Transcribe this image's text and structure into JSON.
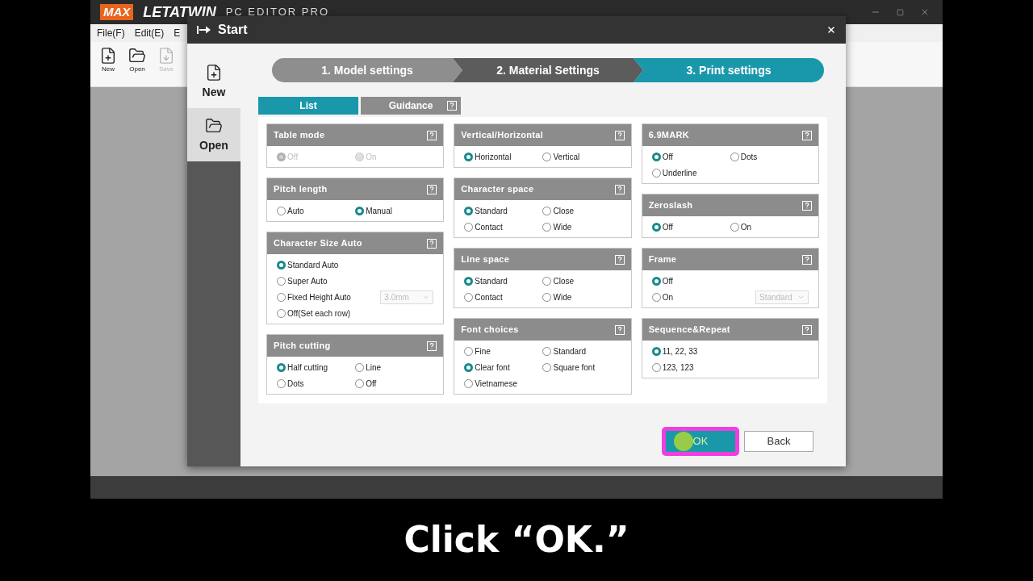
{
  "app": {
    "logo_badge": "MAX",
    "logo_name": "LETATWIN",
    "logo_product": "PC EDITOR PRO"
  },
  "menu": [
    "File(F)",
    "Edit(E)",
    "E"
  ],
  "toolbar": [
    {
      "label": "New",
      "kind": "new",
      "disabled": false
    },
    {
      "label": "Open",
      "kind": "open",
      "disabled": false
    },
    {
      "label": "Save",
      "kind": "save",
      "disabled": true
    }
  ],
  "dialog": {
    "title": "Start",
    "sidebar": [
      {
        "label": "New",
        "kind": "new",
        "selected": false
      },
      {
        "label": "Open",
        "kind": "open",
        "selected": true
      }
    ],
    "steps": [
      {
        "label": "1. Model settings",
        "kind": "pending"
      },
      {
        "label": "2. Material Settings",
        "kind": "done"
      },
      {
        "label": "3. Print settings",
        "kind": "current"
      }
    ],
    "tabs": [
      {
        "label": "List",
        "selected": true,
        "help": false
      },
      {
        "label": "Guidance",
        "selected": false,
        "help": true
      }
    ],
    "columns": [
      [
        {
          "title": "Table mode",
          "kind": "grid",
          "options": [
            {
              "label": "Off",
              "selected": true,
              "disabled": true
            },
            {
              "label": "On",
              "selected": false,
              "disabled": true
            }
          ]
        },
        {
          "title": "Pitch length",
          "kind": "grid",
          "options": [
            {
              "label": "Auto",
              "selected": false,
              "disabled": false
            },
            {
              "label": "Manual",
              "selected": true,
              "disabled": false
            }
          ]
        },
        {
          "title": "Character Size Auto",
          "kind": "list",
          "options": [
            {
              "label": "Standard Auto",
              "selected": true,
              "disabled": false
            },
            {
              "label": "Super Auto",
              "selected": false,
              "disabled": false
            },
            {
              "label": "Fixed Height Auto",
              "selected": false,
              "disabled": false,
              "dropdown": {
                "value": "3.0mm",
                "disabled": true
              }
            },
            {
              "label": "Off(Set each row)",
              "selected": false,
              "disabled": false
            }
          ]
        },
        {
          "title": "Pitch cutting",
          "kind": "grid",
          "options": [
            {
              "label": "Half cutting",
              "selected": true,
              "disabled": false
            },
            {
              "label": "Line",
              "selected": false,
              "disabled": false
            },
            {
              "label": "Dots",
              "selected": false,
              "disabled": false
            },
            {
              "label": "Off",
              "selected": false,
              "disabled": false
            }
          ]
        }
      ],
      [
        {
          "title": "Vertical/Horizontal",
          "kind": "grid",
          "options": [
            {
              "label": "Horizontal",
              "selected": true,
              "disabled": false
            },
            {
              "label": "Vertical",
              "selected": false,
              "disabled": false
            }
          ]
        },
        {
          "title": "Character space",
          "kind": "grid",
          "options": [
            {
              "label": "Standard",
              "selected": true,
              "disabled": false
            },
            {
              "label": "Close",
              "selected": false,
              "disabled": false
            },
            {
              "label": "Contact",
              "selected": false,
              "disabled": false
            },
            {
              "label": "Wide",
              "selected": false,
              "disabled": false
            }
          ]
        },
        {
          "title": "Line space",
          "kind": "grid",
          "options": [
            {
              "label": "Standard",
              "selected": true,
              "disabled": false
            },
            {
              "label": "Close",
              "selected": false,
              "disabled": false
            },
            {
              "label": "Contact",
              "selected": false,
              "disabled": false
            },
            {
              "label": "Wide",
              "selected": false,
              "disabled": false
            }
          ]
        },
        {
          "title": "Font choices",
          "kind": "grid",
          "options": [
            {
              "label": "Fine",
              "selected": false,
              "disabled": false
            },
            {
              "label": "Standard",
              "selected": false,
              "disabled": false
            },
            {
              "label": "Clear font",
              "selected": true,
              "disabled": false
            },
            {
              "label": "Square font",
              "selected": false,
              "disabled": false
            },
            {
              "label": "Vietnamese",
              "selected": false,
              "disabled": false
            }
          ]
        }
      ],
      [
        {
          "title": "6.9MARK",
          "kind": "grid",
          "options": [
            {
              "label": "Off",
              "selected": true,
              "disabled": false
            },
            {
              "label": "Dots",
              "selected": false,
              "disabled": false
            },
            {
              "label": "Underline",
              "selected": false,
              "disabled": false
            }
          ]
        },
        {
          "title": "Zeroslash",
          "kind": "grid",
          "options": [
            {
              "label": "Off",
              "selected": true,
              "disabled": false
            },
            {
              "label": "On",
              "selected": false,
              "disabled": false
            }
          ]
        },
        {
          "title": "Frame",
          "kind": "list",
          "options": [
            {
              "label": "Off",
              "selected": true,
              "disabled": false
            },
            {
              "label": "On",
              "selected": false,
              "disabled": false,
              "dropdown": {
                "value": "Standard",
                "disabled": true
              }
            }
          ]
        },
        {
          "title": "Sequence&Repeat",
          "kind": "list",
          "options": [
            {
              "label": "11, 22, 33",
              "selected": true,
              "disabled": false
            },
            {
              "label": "123, 123",
              "selected": false,
              "disabled": false
            }
          ]
        }
      ]
    ],
    "buttons": [
      {
        "label": "OK",
        "kind": "primary",
        "highlighted": true
      },
      {
        "label": "Back",
        "kind": "secondary",
        "highlighted": false
      }
    ]
  },
  "caption": "Click “OK.”"
}
